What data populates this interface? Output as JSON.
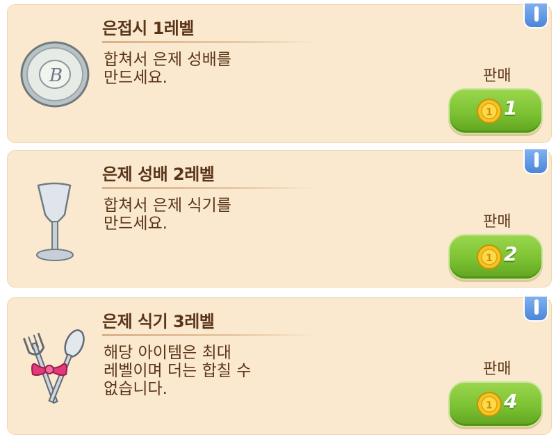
{
  "sell_label": "판매",
  "items": [
    {
      "title": "은접시 1레벨",
      "description": "합쳐서 은제 성배를\n만드세요.",
      "price": "1",
      "icon": "silver-plate-icon"
    },
    {
      "title": "은제 성배 2레벨",
      "description": "합쳐서 은제 식기를\n만드세요.",
      "price": "2",
      "icon": "silver-goblet-icon"
    },
    {
      "title": "은제 식기 3레벨",
      "description": "해당 아이템은 최대\n레벨이며 더는 합칠 수\n없습니다.",
      "price": "4",
      "icon": "silver-cutlery-icon"
    }
  ],
  "colors": {
    "card_bg": "#fbe9cf",
    "text": "#5a3519",
    "button_green": "#7cc233",
    "info_blue": "#4c86d9"
  }
}
